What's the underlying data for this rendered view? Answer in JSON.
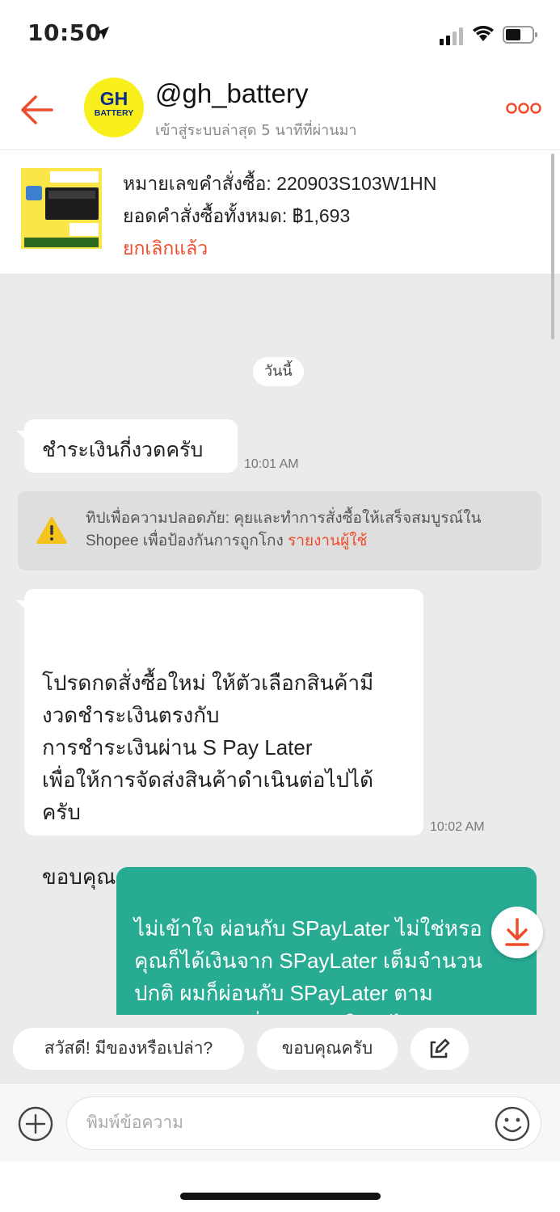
{
  "status_bar": {
    "time": "10:50"
  },
  "header": {
    "shop_name": "@gh_battery",
    "last_seen": "เข้าสู่ระบบล่าสุด 5 นาทีที่ผ่านมา",
    "logo_line1": "GH",
    "logo_line2": "BATTERY"
  },
  "order": {
    "number": "หมายเลขคำสั่งซื้อ: 220903S103W1HN",
    "total": "ยอดคำสั่งซื้อทั้งหมด: ฿1,693",
    "status": "ยกเลิกแล้ว"
  },
  "chat": {
    "date_label": "วันนี้",
    "messages": [
      {
        "text": "ชำระเงินกี่งวดครับ",
        "time": "10:01 AM"
      },
      {
        "text": "โปรดกดสั่งซื้อใหม่ ให้ตัวเลือกสินค้ามี\nงวดชำระเงินตรงกับ\nการชำระเงินผ่าน S Pay Later\nเพื่อให้การจัดส่งสินค้าดำเนินต่อไปได้\nครับ\n\nขอบคุณครับ",
        "time": "10:02 AM"
      },
      {
        "text": "ไม่เข้าใจ ผ่อนกับ SPayLater ไม่ใช่หรอ\nคุณก็ได้เงินจาก SPayLater เต็มจำนวน\nปกติ ผมก็ผ่อนกับ SPayLater ตาม\nจำนวนเดือนที่เลือก เข้าใจอะไรผิดกับ\nการผ่อนแบบนี้หรือเปล่าครับ"
      }
    ],
    "tip": {
      "text": "ทิปเพื่อความปลอดภัย: คุยและทำการสั่งซื้อให้เสร็จสมบูรณ์ใน Shopee เพื่อป้องกันการถูกโกง",
      "link": "รายงานผู้ใช้"
    }
  },
  "quick_replies": [
    "สวัสดี! มีของหรือเปล่า?",
    "ขอบคุณครับ"
  ],
  "input": {
    "placeholder": "พิมพ์ข้อความ"
  },
  "colors": {
    "accent": "#ee4d2d",
    "outgoing_bubble": "#27ab93",
    "chat_bg": "#ebebeb"
  }
}
